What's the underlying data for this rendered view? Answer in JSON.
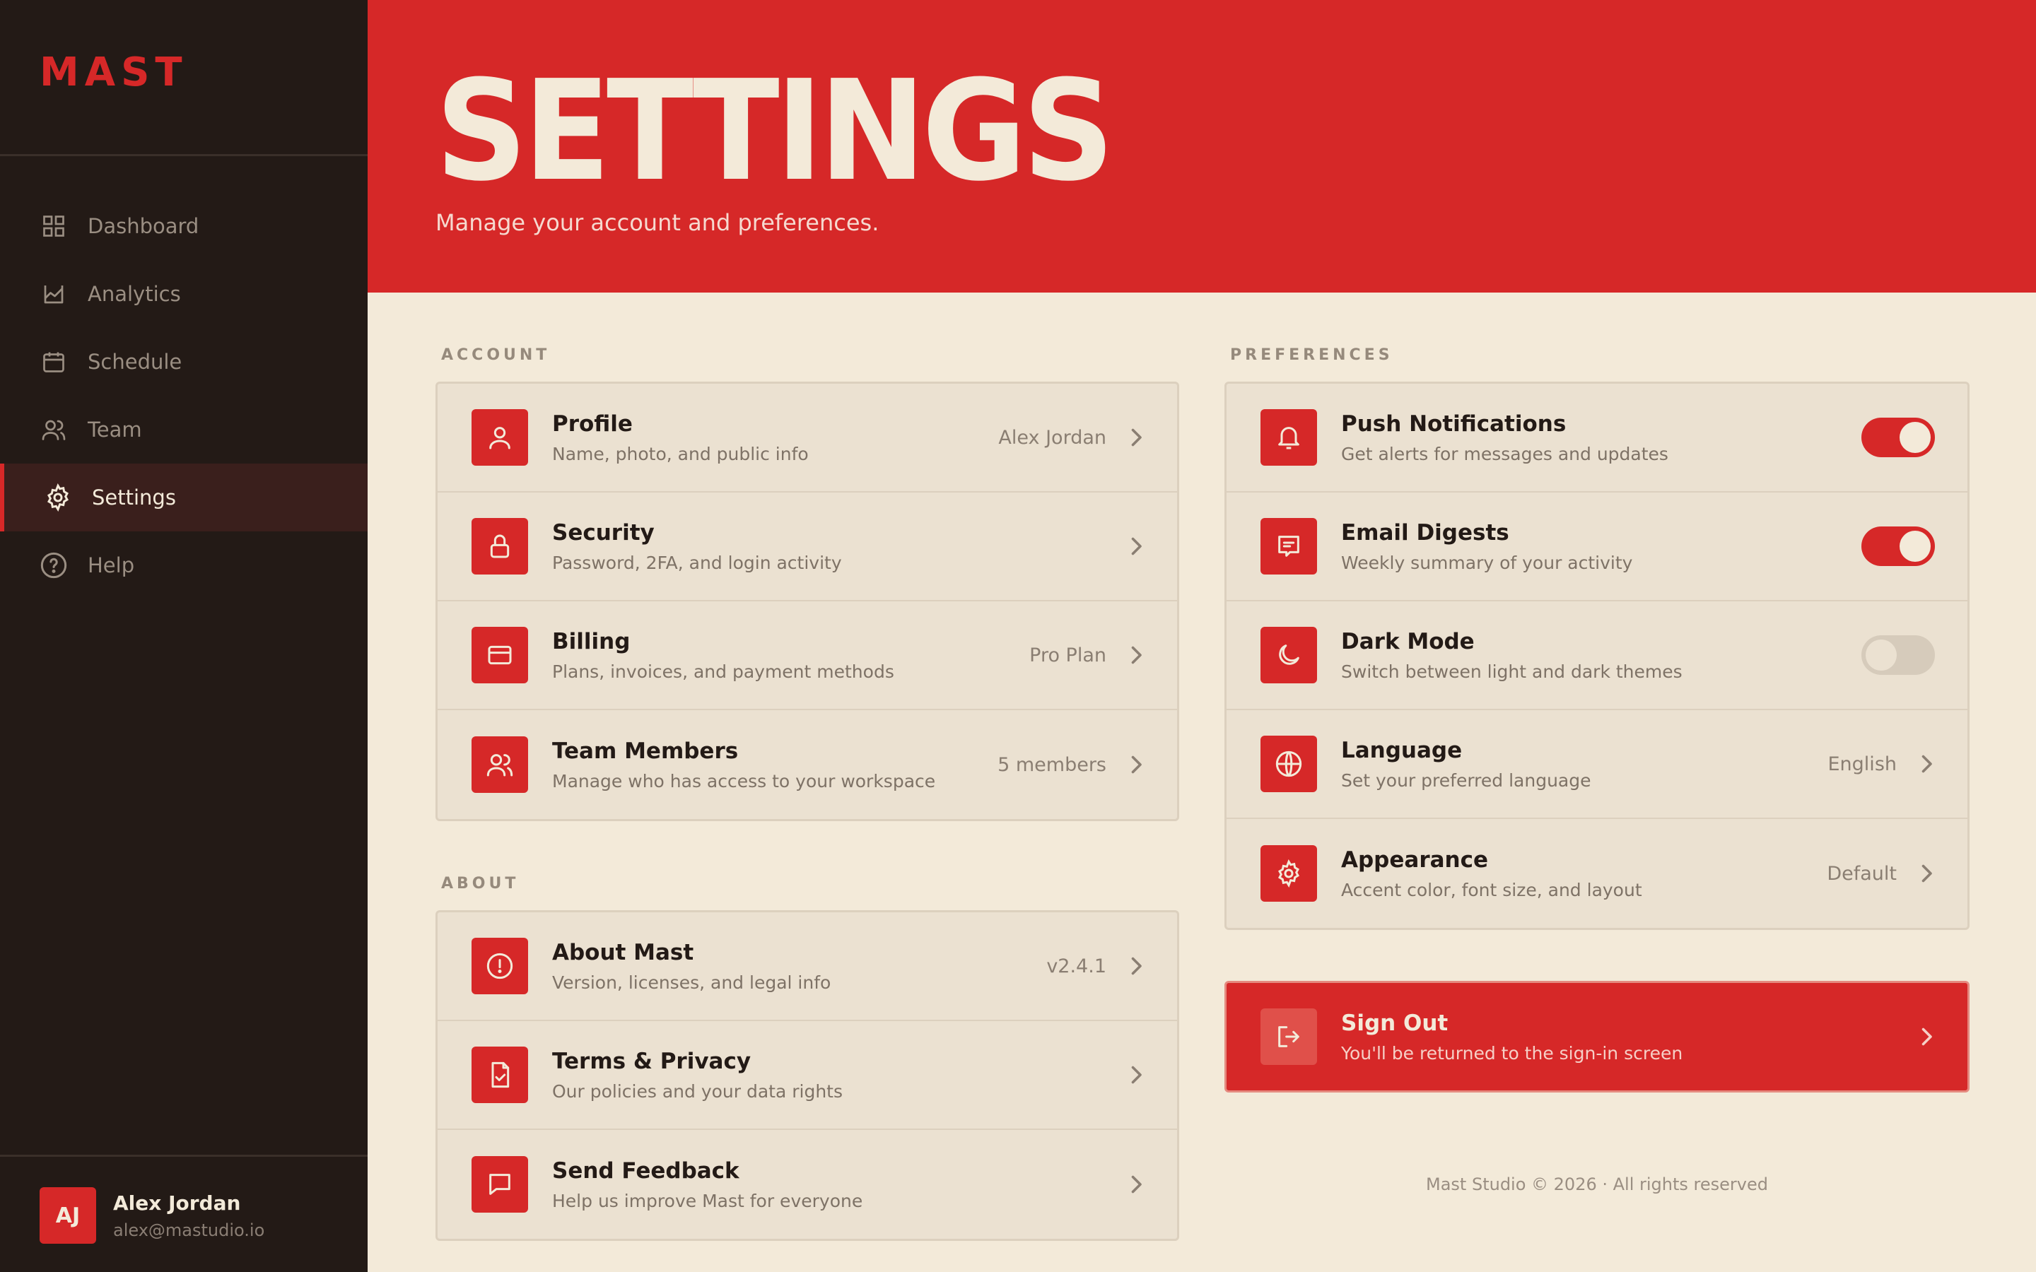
{
  "app": {
    "logo": "MAST"
  },
  "sidebar": {
    "items": [
      {
        "label": "Dashboard",
        "icon": "grid-icon"
      },
      {
        "label": "Analytics",
        "icon": "chart-icon"
      },
      {
        "label": "Schedule",
        "icon": "calendar-icon"
      },
      {
        "label": "Team",
        "icon": "users-icon"
      },
      {
        "label": "Settings",
        "icon": "gear-icon",
        "active": true
      },
      {
        "label": "Help",
        "icon": "help-icon"
      }
    ],
    "user": {
      "initials": "AJ",
      "name": "Alex Jordan",
      "email": "alex@mastudio.io"
    }
  },
  "header": {
    "title": "SETTINGS",
    "subtitle": "Manage your account and preferences."
  },
  "account": {
    "label": "ACCOUNT",
    "rows": [
      {
        "title": "Profile",
        "subtitle": "Name, photo, and public info",
        "value": "Alex Jordan",
        "icon": "user-icon"
      },
      {
        "title": "Security",
        "subtitle": "Password, 2FA, and login activity",
        "value": "",
        "icon": "lock-icon"
      },
      {
        "title": "Billing",
        "subtitle": "Plans, invoices, and payment methods",
        "value": "Pro Plan",
        "icon": "credit-card-icon"
      },
      {
        "title": "Team Members",
        "subtitle": "Manage who has access to your workspace",
        "value": "5 members",
        "icon": "users-icon"
      }
    ]
  },
  "about": {
    "label": "ABOUT",
    "rows": [
      {
        "title": "About Mast",
        "subtitle": "Version, licenses, and legal info",
        "value": "v2.4.1",
        "icon": "info-icon"
      },
      {
        "title": "Terms & Privacy",
        "subtitle": "Our policies and your data rights",
        "value": "",
        "icon": "document-check-icon"
      },
      {
        "title": "Send Feedback",
        "subtitle": "Help us improve Mast for everyone",
        "value": "",
        "icon": "message-icon"
      }
    ]
  },
  "preferences": {
    "label": "PREFERENCES",
    "rows": [
      {
        "title": "Push Notifications",
        "subtitle": "Get alerts for messages and updates",
        "toggle": true,
        "icon": "bell-icon"
      },
      {
        "title": "Email Digests",
        "subtitle": "Weekly summary of your activity",
        "toggle": true,
        "icon": "digest-icon"
      },
      {
        "title": "Dark Mode",
        "subtitle": "Switch between light and dark themes",
        "toggle": false,
        "icon": "moon-icon"
      },
      {
        "title": "Language",
        "subtitle": "Set your preferred language",
        "value": "English",
        "icon": "globe-icon"
      },
      {
        "title": "Appearance",
        "subtitle": "Accent color, font size, and layout",
        "value": "Default",
        "icon": "palette-icon"
      }
    ]
  },
  "signout": {
    "title": "Sign Out",
    "subtitle": "You'll be returned to the sign-in screen",
    "icon": "sign-out-icon"
  },
  "footer": {
    "text": "Mast Studio © 2026 · All rights reserved"
  },
  "colors": {
    "accent": "#d62828",
    "sidebar": "#231a16",
    "background": "#f3ead9",
    "card": "#ebe1d1"
  }
}
